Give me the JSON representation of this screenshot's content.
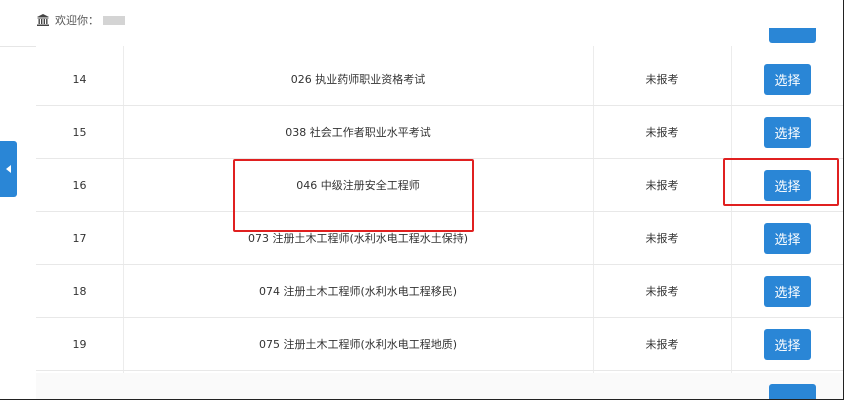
{
  "header": {
    "welcome_text": "欢迎你：",
    "icon": "bank-icon"
  },
  "table": {
    "rows": [
      {
        "index": "14",
        "exam": "026 执业药师职业资格考试",
        "status": "未报考",
        "action": "选择"
      },
      {
        "index": "15",
        "exam": "038 社会工作者职业水平考试",
        "status": "未报考",
        "action": "选择"
      },
      {
        "index": "16",
        "exam": "046 中级注册安全工程师",
        "status": "未报考",
        "action": "选择"
      },
      {
        "index": "17",
        "exam": "073 注册土木工程师(水利水电工程水土保持)",
        "status": "未报考",
        "action": "选择"
      },
      {
        "index": "18",
        "exam": "074 注册土木工程师(水利水电工程移民)",
        "status": "未报考",
        "action": "选择"
      },
      {
        "index": "19",
        "exam": "075 注册土木工程师(水利水电工程地质)",
        "status": "未报考",
        "action": "选择"
      }
    ]
  },
  "colors": {
    "primary": "#2a86d6",
    "highlight": "#e02020"
  }
}
